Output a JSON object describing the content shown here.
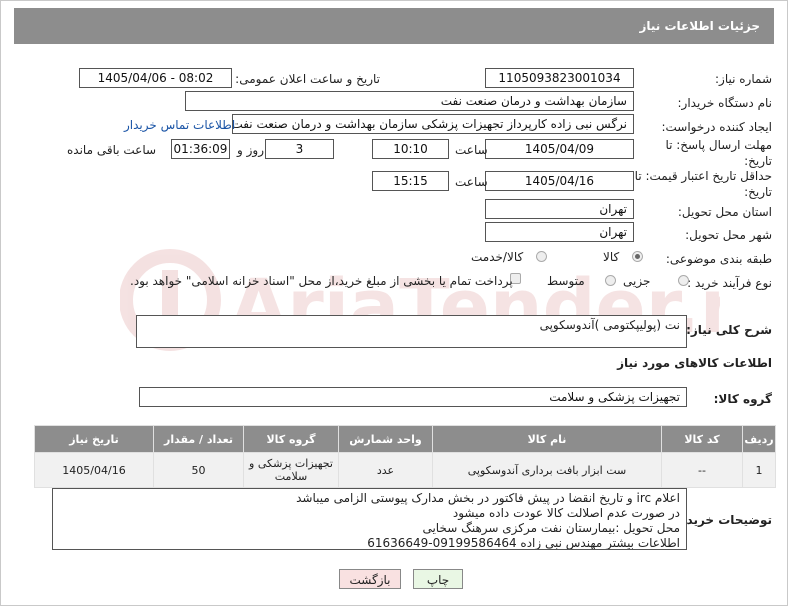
{
  "header": {
    "title": "جزئیات اطلاعات نیاز"
  },
  "fields": {
    "need_number_label": "شماره نیاز:",
    "need_number": "1105093823001034",
    "announce_label": "تاریخ و ساعت اعلان عمومی:",
    "announce_value": "1405/04/06 - 08:02",
    "buyer_org_label": "نام دستگاه خریدار:",
    "buyer_org": "سازمان بهداشت و درمان صنعت نفت",
    "requester_label": "ایجاد کننده درخواست:",
    "requester": "نرگس نبی زاده کارپرداز تجهیزات پزشکی سازمان بهداشت و درمان صنعت نفت",
    "buyer_contact_link": "اطلاعات تماس خریدار",
    "deadline_label": "مهلت ارسال پاسخ: تا تاریخ:",
    "deadline_date": "1405/04/09",
    "time_label": "ساعت",
    "deadline_time": "10:10",
    "days_value": "3",
    "days_label": "روز و",
    "remaining_time": "01:36:09",
    "remaining_label": "ساعت باقی مانده",
    "validity_label": "حداقل تاریخ اعتبار قیمت: تا تاریخ:",
    "validity_date": "1405/04/16",
    "validity_time": "15:15",
    "province_label": "استان محل تحویل:",
    "province": "تهران",
    "city_label": "شهر محل تحویل:",
    "city": "تهران",
    "category_label": "طبقه بندی موضوعی:",
    "category_options": [
      "کالا",
      "کالا/خدمت"
    ],
    "process_label": "نوع فرآیند خرید :",
    "process_options": [
      "جزیی",
      "متوسط"
    ],
    "payment_note": "پرداخت تمام یا بخشی از مبلغ خرید،از محل \"اسناد خزانه اسلامی\" خواهد بود.",
    "description_label": "شرح کلی نیاز:",
    "description": "نت (پولیپکتومی )آندوسکوپی",
    "goods_info_title": "اطلاعات کالاهای مورد نیاز",
    "goods_group_label": "گروه کالا:",
    "goods_group": "تجهیزات پزشکی و سلامت"
  },
  "table": {
    "headers": [
      "ردیف",
      "کد کالا",
      "نام کالا",
      "واحد شمارش",
      "گروه کالا",
      "تعداد / مقدار",
      "تاریخ نیاز"
    ],
    "rows": [
      [
        "1",
        "--",
        "ست ابزار بافت برداری آندوسکوپی",
        "عدد",
        "تجهیزات پزشکی و سلامت",
        "50",
        "1405/04/16"
      ]
    ]
  },
  "buyer_notes": {
    "label": "توضیحات خریدار:",
    "lines": [
      "اعلام irc و تاریخ انقضا در پیش فاکتور در بخش مدارک پیوستی الزامی میباشد",
      "در صورت عدم اصلالت کالا عودت داده میشود",
      "محل تحویل :بیمارستان نفت مرکزی سرهنگ سخایی",
      "اطلاعات بیشتر  مهندس نبی زاده 09199586464-61636649"
    ]
  },
  "buttons": {
    "print": "چاپ",
    "back": "بازگشت"
  },
  "watermark": {
    "text": "AriaTender.net"
  },
  "colors": {
    "header_bg": "#8d8d8d",
    "link": "#1a54a6",
    "print_bg": "#e9f7e4",
    "back_bg": "#f9e1e1"
  }
}
